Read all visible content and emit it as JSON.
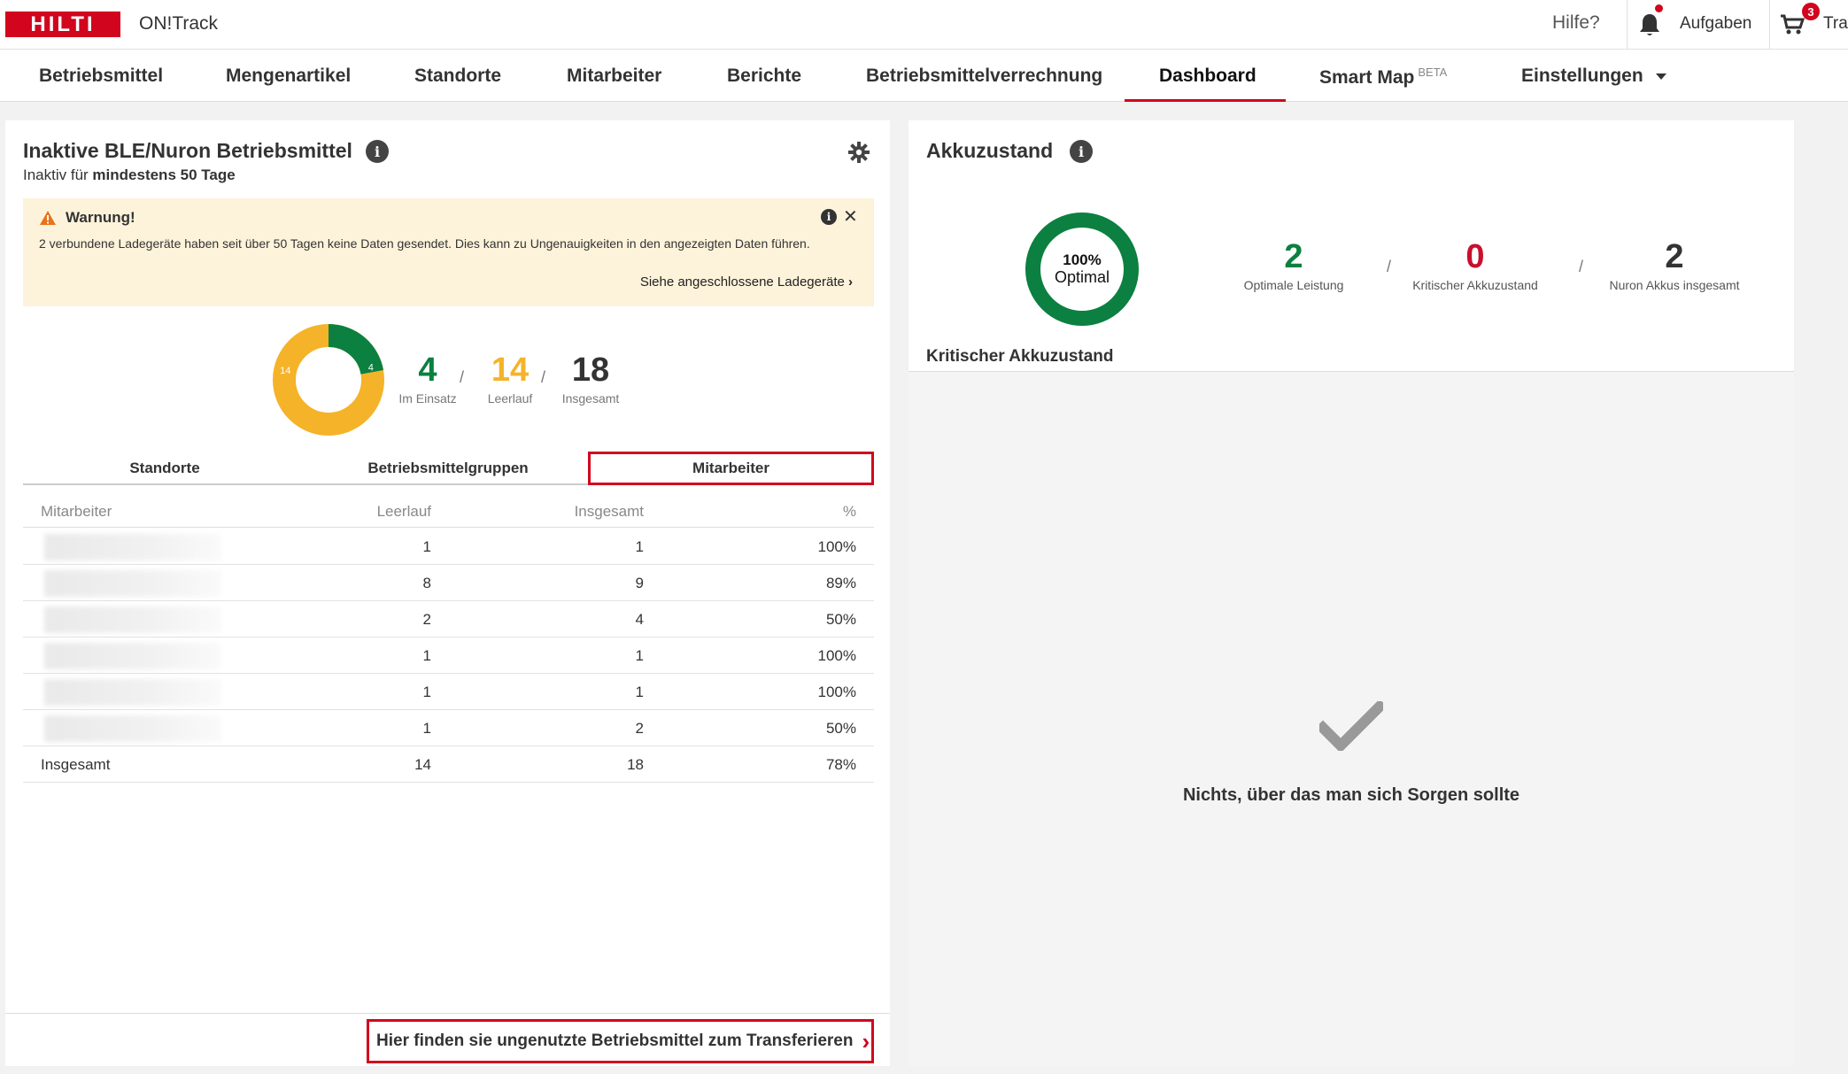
{
  "header": {
    "logo": "HILTI",
    "app_name": "ON!Track",
    "help": "Hilfe?",
    "tasks": "Aufgaben",
    "cart_count": "3",
    "cart_label": "Tra"
  },
  "nav": {
    "items": [
      "Betriebsmittel",
      "Mengenartikel",
      "Standorte",
      "Mitarbeiter",
      "Berichte",
      "Betriebsmittelverrechnung",
      "Dashboard",
      "Smart Map",
      "Einstellungen"
    ],
    "beta": "BETA",
    "active": "Dashboard"
  },
  "inactive": {
    "title": "Inaktive BLE/Nuron Betriebsmittel",
    "subtitle_prefix": "Inaktiv für ",
    "subtitle_bold": "mindestens 50 Tage",
    "warning": {
      "title": "Warnung!",
      "text": "2 verbundene Ladegeräte haben seit über 50 Tagen keine Daten gesendet. Dies kann zu Ungenauigkeiten in den angezeigten Daten führen.",
      "link": "Siehe angeschlossene Ladegeräte"
    },
    "donut": {
      "in_use": 4,
      "idle": 14,
      "label_in_use": "4",
      "label_idle": "14"
    },
    "stats": [
      {
        "value": "4",
        "label": "Im Einsatz",
        "color": "#0b8040"
      },
      {
        "value": "14",
        "label": "Leerlauf",
        "color": "#f5b32a"
      },
      {
        "value": "18",
        "label": "Insgesamt",
        "color": "#333333"
      }
    ],
    "slash": "/",
    "tabs": [
      "Standorte",
      "Betriebsmittelgruppen",
      "Mitarbeiter"
    ],
    "table": {
      "headers": [
        "Mitarbeiter",
        "Leerlauf",
        "Insgesamt",
        "%"
      ],
      "rows": [
        [
          "1",
          "1",
          "100%"
        ],
        [
          "8",
          "9",
          "89%"
        ],
        [
          "2",
          "4",
          "50%"
        ],
        [
          "1",
          "1",
          "100%"
        ],
        [
          "1",
          "1",
          "100%"
        ],
        [
          "1",
          "2",
          "50%"
        ]
      ],
      "total": [
        "Insgesamt",
        "14",
        "18",
        "78%"
      ]
    },
    "transfer_link": "Hier finden sie ungenutzte Betriebsmittel zum Transferieren"
  },
  "battery": {
    "title": "Akkuzustand",
    "ring_percent": "100%",
    "ring_label": "Optimal",
    "stats": [
      {
        "value": "2",
        "label": "Optimale Leistung",
        "color": "#0b8040"
      },
      {
        "value": "0",
        "label": "Kritischer Akkuzustand",
        "color": "#c8102e"
      },
      {
        "value": "2",
        "label": "Nuron Akkus insgesamt",
        "color": "#333333"
      }
    ],
    "critical_title": "Kritischer Akkuzustand",
    "empty_message": "Nichts, über das man sich Sorgen sollte"
  },
  "colors": {
    "brand": "#d2051e",
    "green": "#0b8040",
    "amber": "#f5b32a"
  }
}
